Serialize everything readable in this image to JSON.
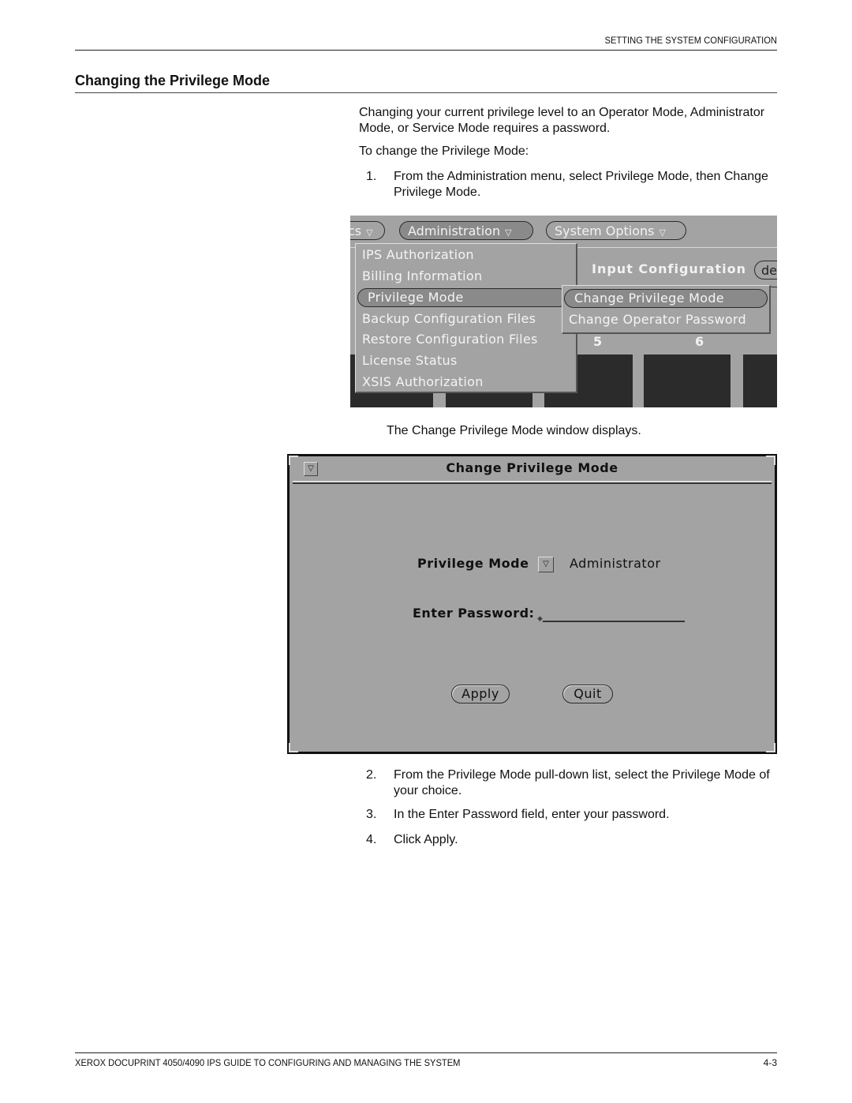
{
  "header": {
    "running_head": "SETTING THE SYSTEM CONFIGURATION",
    "section_title": "Changing the Privilege Mode"
  },
  "body": {
    "intro": "Changing your current privilege level to an Operator Mode, Administrator Mode, or Service Mode requires a password.",
    "lead_in": "To change the Privilege Mode:",
    "steps": [
      {
        "num": "1.",
        "text": "From the Administration menu, select Privilege Mode, then Change Privilege Mode."
      },
      {
        "num": "2.",
        "text": "From the Privilege Mode pull-down list, select the Privilege Mode of your choice."
      },
      {
        "num": "3.",
        "text": "In the Enter Password field, enter your password."
      },
      {
        "num": "4.",
        "text": "Click Apply."
      }
    ],
    "caption_after_menu": "The Change Privilege Mode window displays."
  },
  "menu_screenshot": {
    "menubar": [
      {
        "label": "cs",
        "arrow": "▽"
      },
      {
        "label": "Administration",
        "arrow": "▽"
      },
      {
        "label": "System Options",
        "arrow": "▽"
      }
    ],
    "admin_menu": [
      "IPS Authorization",
      "Billing Information",
      "Privilege Mode",
      "Backup Configuration Files",
      "Restore Configuration Files",
      "License Status",
      "XSIS Authorization"
    ],
    "selected_item": "Privilege Mode",
    "submenu": [
      "Change Privilege Mode",
      "Change Operator Password"
    ],
    "selected_subitem": "Change Privilege Mode",
    "background_panel_title": "Input Configuration",
    "background_button_partial": "de",
    "column_numbers": [
      "5",
      "6"
    ]
  },
  "dialog": {
    "title": "Change Privilege Mode",
    "window_menu_icon": "▽",
    "privilege_mode_label": "Privilege Mode",
    "privilege_mode_value": "Administrator",
    "dropdown_icon": "▽",
    "password_label": "Enter Password:",
    "password_value": "",
    "apply_label": "Apply",
    "quit_label": "Quit"
  },
  "footer": {
    "left": "XEROX DOCUPRINT 4050/4090 IPS GUIDE TO CONFIGURING AND MANAGING THE SYSTEM",
    "page": "4-3"
  }
}
